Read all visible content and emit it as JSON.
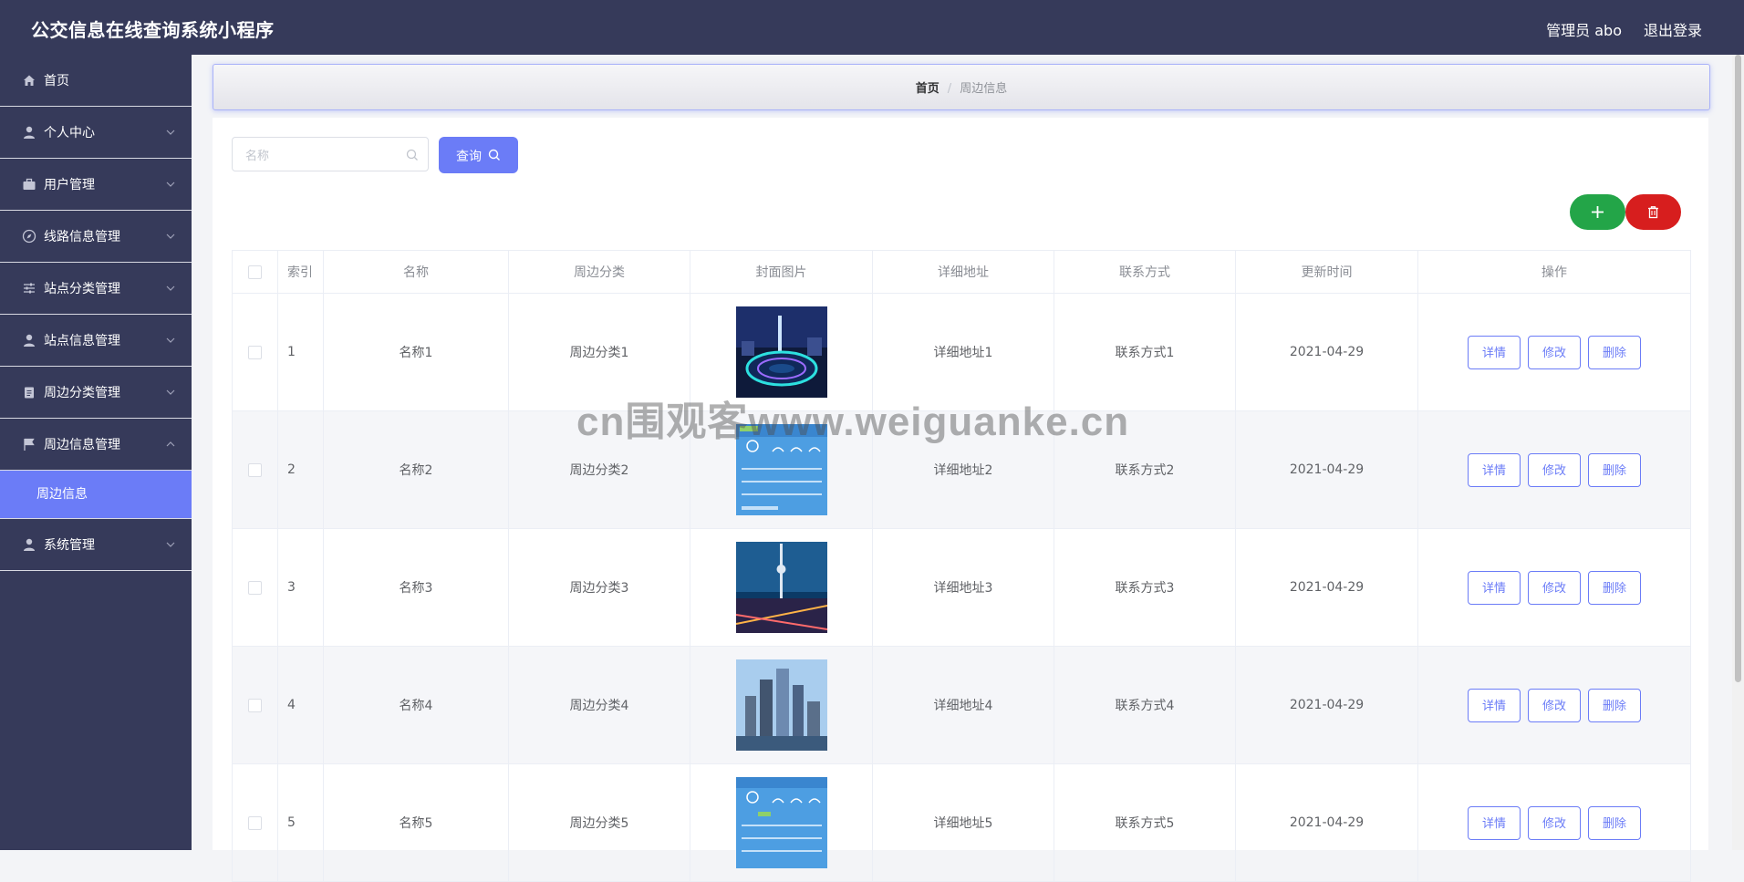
{
  "app": {
    "title": "公交信息在线查询系统小程序",
    "admin": "管理员 abo",
    "logout": "退出登录"
  },
  "sidebar": {
    "items": [
      {
        "label": "首页",
        "icon": "home-icon"
      },
      {
        "label": "个人中心",
        "icon": "user-icon"
      },
      {
        "label": "用户管理",
        "icon": "briefcase-icon"
      },
      {
        "label": "线路信息管理",
        "icon": "compass-icon"
      },
      {
        "label": "站点分类管理",
        "icon": "sliders-icon"
      },
      {
        "label": "站点信息管理",
        "icon": "user-icon"
      },
      {
        "label": "周边分类管理",
        "icon": "clipboard-icon"
      },
      {
        "label": "周边信息管理",
        "icon": "flag-icon"
      },
      {
        "label": "系统管理",
        "icon": "user-icon"
      }
    ],
    "submenu_label": "周边信息"
  },
  "breadcrumb": {
    "home": "首页",
    "current": "周边信息"
  },
  "search": {
    "placeholder": "名称",
    "value": "",
    "button": "查询"
  },
  "table": {
    "columns": [
      "索引",
      "名称",
      "周边分类",
      "封面图片",
      "详细地址",
      "联系方式",
      "更新时间",
      "操作"
    ],
    "actions": {
      "detail": "详情",
      "edit": "修改",
      "delete": "删除"
    },
    "rows": [
      {
        "index": "1",
        "name": "名称1",
        "category": "周边分类1",
        "address": "详细地址1",
        "contact": "联系方式1",
        "updated": "2021-04-29"
      },
      {
        "index": "2",
        "name": "名称2",
        "category": "周边分类2",
        "address": "详细地址2",
        "contact": "联系方式2",
        "updated": "2021-04-29"
      },
      {
        "index": "3",
        "name": "名称3",
        "category": "周边分类3",
        "address": "详细地址3",
        "contact": "联系方式3",
        "updated": "2021-04-29"
      },
      {
        "index": "4",
        "name": "名称4",
        "category": "周边分类4",
        "address": "详细地址4",
        "contact": "联系方式4",
        "updated": "2021-04-29"
      },
      {
        "index": "5",
        "name": "名称5",
        "category": "周边分类5",
        "address": "详细地址5",
        "contact": "联系方式5",
        "updated": "2021-04-29"
      }
    ]
  },
  "watermark": "cn围观客www.weiguanke.cn",
  "colors": {
    "header": "#363a5a",
    "accent": "#6b7cf7",
    "add": "#23a548",
    "delete": "#d71e1e"
  }
}
